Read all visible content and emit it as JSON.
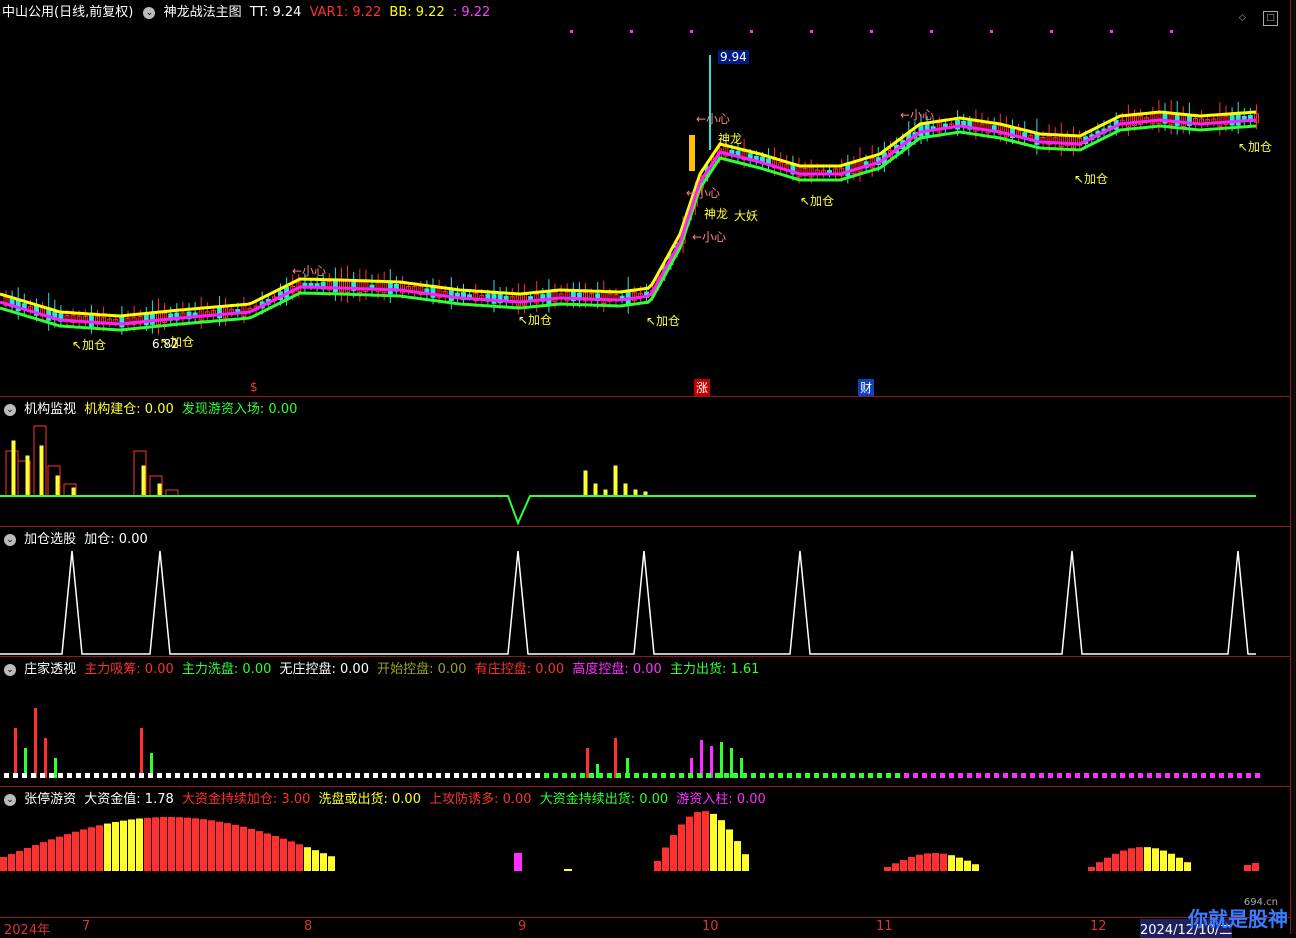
{
  "main": {
    "stock": "中山公用",
    "period": "(日线,前复权)",
    "indicator": "神龙战法主图",
    "tt": "TT: 9.24",
    "var1": "VAR1: 9.22",
    "bb": "BB: 9.22",
    "extra": ": 9.22",
    "high_label": "9.94",
    "low_label": "6.82",
    "annotations": {
      "jiacang": "加仓",
      "xiaoxin": "←小心",
      "shenlong": "神龙",
      "dayao": "大妖",
      "arrow_jiacang": "↖加仓"
    },
    "markers": {
      "s": "$",
      "zhang": "涨",
      "cai": "财"
    },
    "colors": {
      "up": "#ff3030",
      "down": "#30e0e0",
      "ma_slow": "#ffff00",
      "ma_fast": "#ff20ff",
      "ma_green": "#30ff30"
    }
  },
  "panel1": {
    "title": "机构监视",
    "label1": "机构建仓: 0.00",
    "label2": "发现游资入场: 0.00"
  },
  "panel2": {
    "title": "加仓选股",
    "label1": "加仓: 0.00"
  },
  "panel3": {
    "title": "庄家透视",
    "l1": "主力吸筹: 0.00",
    "l2": "主力洗盘: 0.00",
    "l3": "无庄控盘: 0.00",
    "l4": "开始控盘: 0.00",
    "l5": "有庄控盘: 0.00",
    "l6": "高度控盘: 0.00",
    "l7": "主力出货: 1.61"
  },
  "panel4": {
    "title": "张停游资",
    "l1": "大资金值: 1.78",
    "l2": "大资金持续加仓: 3.00",
    "l3": "洗盘或出货: 0.00",
    "l4": "上攻防诱多: 0.00",
    "l5": "大资金持续出货: 0.00",
    "l6": "游资入柱: 0.00"
  },
  "xaxis": {
    "labels": [
      "2024年",
      "7",
      "8",
      "9",
      "10",
      "11",
      "12",
      "2024/12/10/二"
    ]
  },
  "watermark": "你就是股神",
  "watermark_site": "694.cn"
}
